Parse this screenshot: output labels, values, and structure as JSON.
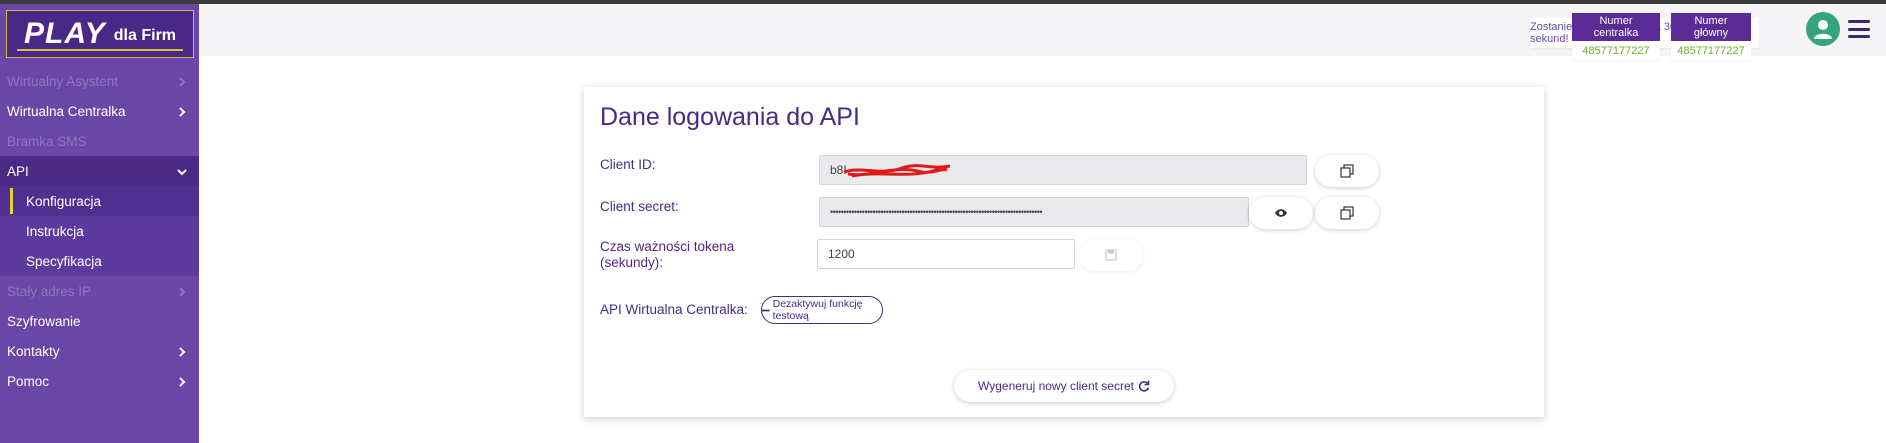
{
  "sidebar": {
    "logo": {
      "brand": "PLAY",
      "suffix": "dla Firm"
    },
    "items": [
      {
        "label": "Wirtualny Asystent",
        "disabled": true,
        "chevron": "chevron-right"
      },
      {
        "label": "Wirtualna Centralka",
        "disabled": false,
        "chevron": "chevron-right"
      },
      {
        "label": "Bramka SMS",
        "disabled": true,
        "chevron": ""
      },
      {
        "label": "API",
        "disabled": false,
        "active": true,
        "chevron": "chevron-down"
      }
    ],
    "api_subitems": [
      {
        "label": "Konfiguracja",
        "current": true
      },
      {
        "label": "Instrukcja"
      },
      {
        "label": "Specyfikacja"
      }
    ],
    "items_after": [
      {
        "label": "Stały adres IP",
        "disabled": true,
        "chevron": "chevron-right"
      },
      {
        "label": "Szyfrowanie",
        "disabled": false,
        "chevron": ""
      },
      {
        "label": "Kontakty",
        "disabled": false,
        "chevron": "chevron-right"
      },
      {
        "label": "Pomoc",
        "disabled": false,
        "chevron": "chevron-right"
      }
    ]
  },
  "header": {
    "logout_text": "Zostaniesz wylogowany za 30 minut i 0 sekund!",
    "numer_centralka": {
      "label": "Numer centralka",
      "value": "48577177227"
    },
    "numer_glowny": {
      "label": "Numer główny",
      "value": "48577177227"
    }
  },
  "card": {
    "title": "Dane logowania do API",
    "client_id": {
      "label": "Client ID:",
      "value": "b8I"
    },
    "client_secret": {
      "label": "Client secret:",
      "value": "••••••••••••••••••••••••••••••••••••••••••••••••••••••••••••••••••••••••••••••••"
    },
    "token": {
      "label_line1": "Czas ważności tokena",
      "label_line2": "(sekundy):",
      "value": "1200"
    },
    "api_centralka": {
      "label": "API Wirtualna Centralka:",
      "button": "Dezaktywuj funkcję testową"
    },
    "generate_button": "Wygeneruj nowy client secret"
  },
  "colors": {
    "sidebar_bg": "#6a47a7",
    "sidebar_active": "#4a2a85",
    "brand_purple": "#5b2c95",
    "accent_yellow": "#e6d23a",
    "number_green": "#6fae2c",
    "avatar_green": "#36a57d"
  }
}
